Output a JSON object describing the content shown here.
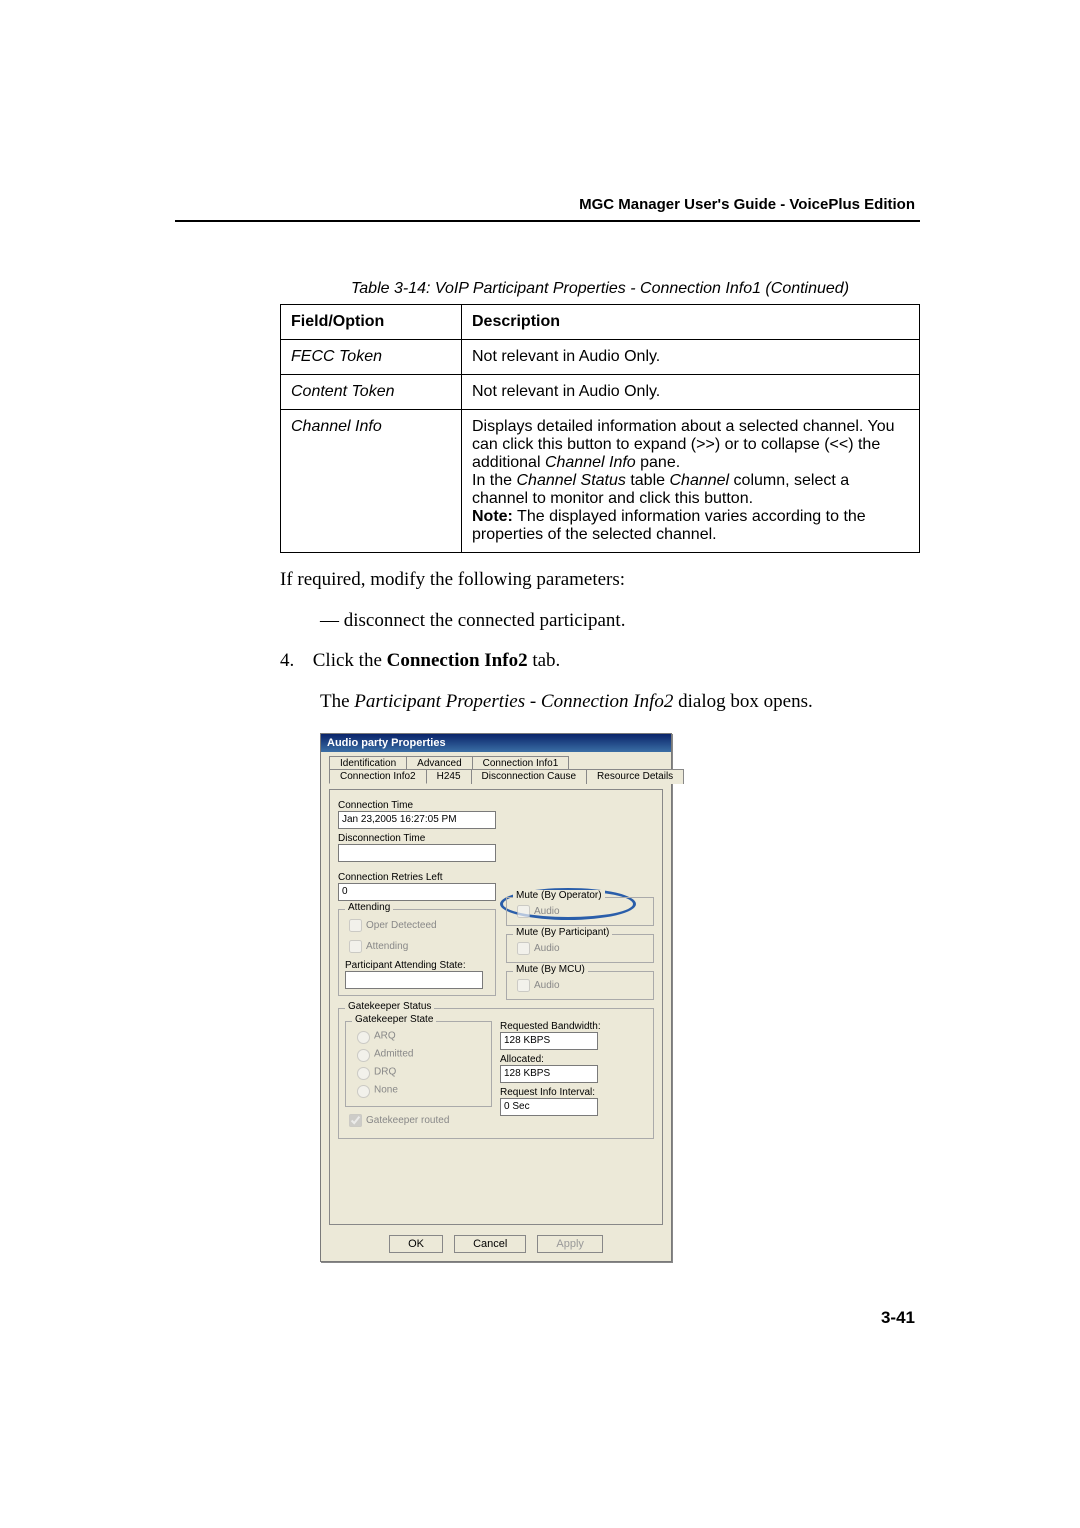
{
  "header": {
    "guide_title": "MGC Manager User's Guide - VoicePlus Edition"
  },
  "table": {
    "caption": "Table 3-14: VoIP Participant Properties - Connection Info1 (Continued)",
    "header_field": "Field/Option",
    "header_desc": "Description",
    "rows": [
      {
        "field": "FECC Token",
        "desc": "Not relevant in Audio Only."
      },
      {
        "field": "Content Token",
        "desc": "Not relevant in Audio Only."
      },
      {
        "field": "Channel Info",
        "desc_parts": {
          "p1": "Displays detailed information about a selected channel. You can click this button to expand (>>) or to collapse (<<) the additional ",
          "p1_em": "Channel Info",
          "p1_after": " pane.",
          "p2_before": "In the ",
          "p2_em1": "Channel Status",
          "p2_mid": " table ",
          "p2_em2": "Channel",
          "p2_after": " column, select a channel to monitor and click this button.",
          "p3_bold": "Note:",
          "p3_after": " The displayed information varies according to the properties of the selected channel."
        }
      }
    ]
  },
  "body": {
    "intro": "If required, modify the following parameters:",
    "dash": "—   disconnect the connected participant.",
    "step_num": "4.",
    "step_before": "Click the ",
    "step_bold": "Connection Info2",
    "step_after": " tab.",
    "result_before": "The ",
    "result_em": "Participant Properties - Connection Info2",
    "result_after": " dialog box opens."
  },
  "dialog": {
    "title": "Audio party Properties",
    "tabs_row1": [
      "Identification",
      "Advanced",
      "Connection Info1"
    ],
    "tabs_row2": [
      "Connection Info2",
      "H245",
      "Disconnection Cause",
      "Resource Details"
    ],
    "labels": {
      "conn_time": "Connection Time",
      "conn_time_val": "Jan 23,2005 16:27:05 PM",
      "disc_time": "Disconnection Time",
      "disc_time_val": "",
      "retries": "Connection Retries Left",
      "retries_val": "0",
      "attending": "Attending",
      "oper_det": "Oper Detecteed",
      "attending_chk": "Attending",
      "pas": "Participant Attending State:",
      "pas_val": "",
      "mute_op": "Mute (By Operator)",
      "mute_part": "Mute (By Participant)",
      "mute_mcu": "Mute (By MCU)",
      "audio": "Audio",
      "gk_status": "Gatekeeper Status",
      "gk_state": "Gatekeeper State",
      "arq": "ARQ",
      "admitted": "Admitted",
      "drq": "DRQ",
      "none": "None",
      "gk_routed": "Gatekeeper routed",
      "req_bw": "Requested Bandwidth:",
      "req_bw_val": "128  KBPS",
      "alloc": "Allocated:",
      "alloc_val": "128  KBPS",
      "req_int": "Request Info Interval:",
      "req_int_val": "0  Sec",
      "ok": "OK",
      "cancel": "Cancel",
      "apply": "Apply"
    }
  },
  "page_number": "3-41"
}
